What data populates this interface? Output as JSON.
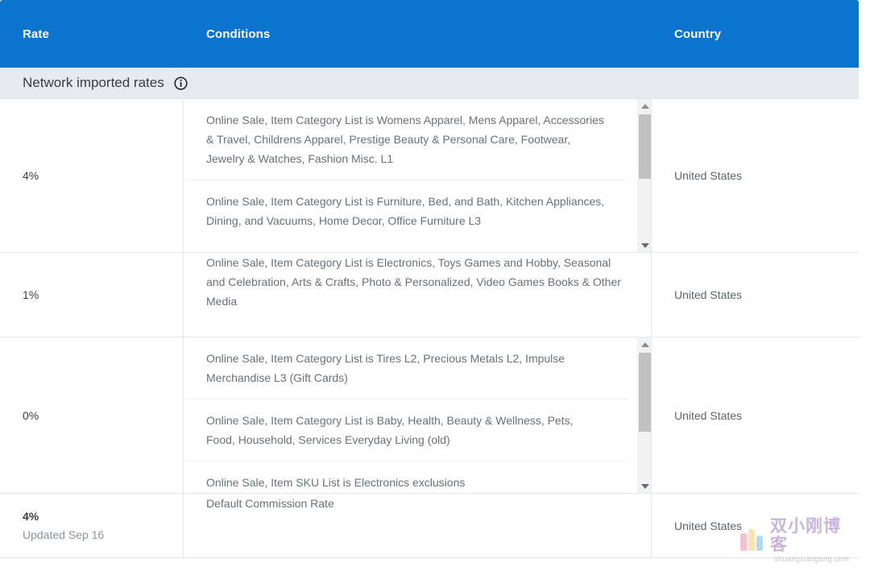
{
  "theme": {
    "header_bg": "#0a74ce",
    "header_text": "#ffffff",
    "group_band_bg": "#e5ebee",
    "row_border": "#e3e9ed",
    "body_text": "#6a7177",
    "muted_text": "#8d9499",
    "scrollbar_track": "#f2f2f2",
    "scrollbar_thumb": "#c1c1c1"
  },
  "table": {
    "columns": [
      {
        "key": "rate",
        "label": "Rate"
      },
      {
        "key": "conditions",
        "label": "Conditions"
      },
      {
        "key": "country",
        "label": "Country"
      }
    ],
    "group": {
      "label": "Network imported rates",
      "info_icon": "info-circle-icon"
    },
    "rows": [
      {
        "rate": "4%",
        "rate_bold": false,
        "updated": "",
        "country": "United States",
        "scrollable": true,
        "conditions": [
          "Online Sale, Item Category List is Womens Apparel, Mens Apparel, Accessories & Travel, Childrens Apparel, Prestige Beauty & Personal Care, Footwear, Jewelry & Watches, Fashion Misc. L1",
          "Online Sale, Item Category List is Furniture, Bed, and Bath, Kitchen Appliances, Dining, and Vacuums, Home Decor, Office Furniture L3"
        ]
      },
      {
        "rate": "1%",
        "rate_bold": false,
        "updated": "",
        "country": "United States",
        "scrollable": false,
        "conditions": [
          "Online Sale, Item Category List is Electronics, Toys Games and Hobby, Seasonal and Celebration, Arts & Crafts, Photo & Personalized, Video Games Books & Other Media"
        ]
      },
      {
        "rate": "0%",
        "rate_bold": false,
        "updated": "",
        "country": "United States",
        "scrollable": true,
        "conditions": [
          "Online Sale, Item Category List is Tires L2, Precious Metals L2, Impulse Merchandise L3 (Gift Cards)",
          "Online Sale, Item Category List is Baby, Health, Beauty & Wellness, Pets, Food, Household, Services Everyday Living (old)",
          "Online Sale, Item SKU List is Electronics exclusions"
        ]
      },
      {
        "rate": "4%",
        "rate_bold": true,
        "updated": "Updated Sep 16",
        "country": "United States",
        "scrollable": false,
        "conditions": [
          "Default Commission Rate"
        ]
      }
    ]
  },
  "watermark": {
    "title": "双小刚博客",
    "subtitle": "shuangxiaogang.com"
  }
}
